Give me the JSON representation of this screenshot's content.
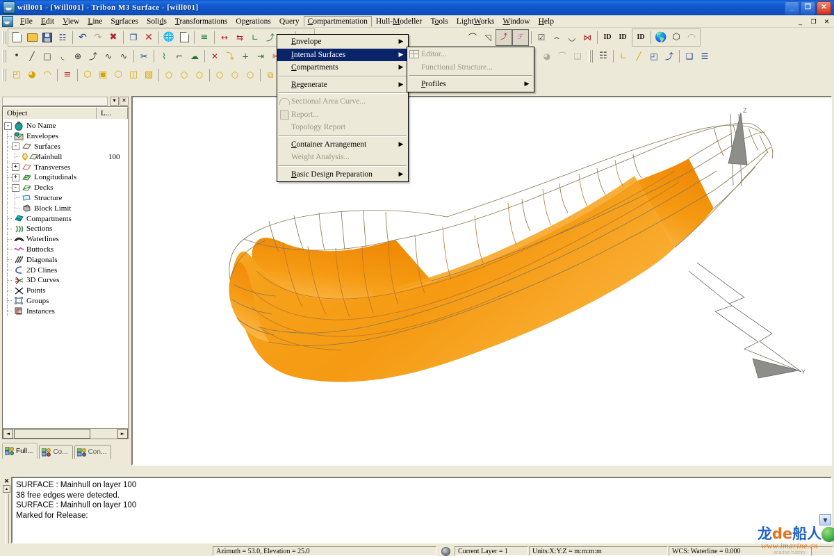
{
  "window": {
    "title": "will001 - [Will001] - Tribon M3 Surface - [will001]",
    "minimize": "_",
    "restore": "❐",
    "close": "✕",
    "mdi_minimize": "_",
    "mdi_restore": "❐",
    "mdi_close": "✕"
  },
  "menubar": {
    "items": [
      {
        "label": "File"
      },
      {
        "label": "Edit"
      },
      {
        "label": "View"
      },
      {
        "label": "Line"
      },
      {
        "label": "Surfaces"
      },
      {
        "label": "Solids"
      },
      {
        "label": "Transformations"
      },
      {
        "label": "Operations"
      },
      {
        "label": "Query"
      },
      {
        "label": "Compartmentation"
      },
      {
        "label": "Hull-Modeller"
      },
      {
        "label": "Tools"
      },
      {
        "label": "LightWorks"
      },
      {
        "label": "Window"
      },
      {
        "label": "Help"
      }
    ]
  },
  "compartmentation_menu": {
    "items": [
      {
        "label": "Envelope",
        "arrow": "▶",
        "disabled": false,
        "highlight": false
      },
      {
        "label": "Internal Surfaces",
        "arrow": "▶",
        "disabled": false,
        "highlight": true
      },
      {
        "label": "Compartments",
        "arrow": "▶",
        "disabled": false,
        "highlight": false
      },
      {
        "separator": true
      },
      {
        "label": "Regenerate",
        "arrow": "▶",
        "disabled": false,
        "highlight": false
      },
      {
        "separator": true
      },
      {
        "label": "Sectional Area Curve...",
        "arrow": "",
        "disabled": true,
        "highlight": false
      },
      {
        "label": "Report...",
        "arrow": "",
        "disabled": true,
        "highlight": false
      },
      {
        "label": "Topology Report",
        "arrow": "",
        "disabled": true,
        "highlight": false
      },
      {
        "separator": true
      },
      {
        "label": "Container Arrangement",
        "arrow": "▶",
        "disabled": false,
        "highlight": false
      },
      {
        "label": "Weight Analysis...",
        "arrow": "",
        "disabled": true,
        "highlight": false
      },
      {
        "separator": true
      },
      {
        "label": "Basic Design Preparation",
        "arrow": "▶",
        "disabled": false,
        "highlight": false
      }
    ]
  },
  "internal_surfaces_submenu": {
    "items": [
      {
        "label": "Editor...",
        "arrow": "",
        "disabled": true,
        "icon": true
      },
      {
        "label": "Functional Structure...",
        "arrow": "",
        "disabled": true,
        "icon": false
      },
      {
        "separator": true
      },
      {
        "label": "Profiles",
        "arrow": "▶",
        "disabled": false,
        "icon": false
      }
    ]
  },
  "sidebar": {
    "columns": [
      "Object",
      "L..."
    ],
    "tree": [
      {
        "label": "No Name",
        "value": "",
        "depth": 0,
        "expander": "-",
        "icon": "ship-icon"
      },
      {
        "label": "Envelopes",
        "value": "",
        "depth": 1,
        "expander": "",
        "icon": "envelopes-icon"
      },
      {
        "label": "Surfaces",
        "value": "",
        "depth": 1,
        "expander": "-",
        "icon": "surfaces-icon"
      },
      {
        "label": "Mainhull",
        "value": "100",
        "depth": 2,
        "expander": "",
        "icon": "mainhull-icon"
      },
      {
        "label": "Transverses",
        "value": "",
        "depth": 1,
        "expander": "+",
        "icon": "transverses-icon"
      },
      {
        "label": "Longitudinals",
        "value": "",
        "depth": 1,
        "expander": "+",
        "icon": "longitudinals-icon"
      },
      {
        "label": "Decks",
        "value": "",
        "depth": 1,
        "expander": "-",
        "icon": "decks-icon"
      },
      {
        "label": "Structure",
        "value": "",
        "depth": 2,
        "expander": "",
        "icon": "structure-icon"
      },
      {
        "label": "Block Limit",
        "value": "",
        "depth": 2,
        "expander": "",
        "icon": "block-limit-icon"
      },
      {
        "label": "Compartments",
        "value": "",
        "depth": 1,
        "expander": "",
        "icon": "compartments-icon"
      },
      {
        "label": "Sections",
        "value": "",
        "depth": 1,
        "expander": "",
        "icon": "sections-icon"
      },
      {
        "label": "Waterlines",
        "value": "",
        "depth": 1,
        "expander": "",
        "icon": "waterlines-icon"
      },
      {
        "label": "Buttocks",
        "value": "",
        "depth": 1,
        "expander": "",
        "icon": "buttocks-icon"
      },
      {
        "label": "Diagonals",
        "value": "",
        "depth": 1,
        "expander": "",
        "icon": "diagonals-icon"
      },
      {
        "label": "2D Clines",
        "value": "",
        "depth": 1,
        "expander": "",
        "icon": "2d-clines-icon"
      },
      {
        "label": "3D Curves",
        "value": "",
        "depth": 1,
        "expander": "",
        "icon": "3d-curves-icon"
      },
      {
        "label": "Points",
        "value": "",
        "depth": 1,
        "expander": "",
        "icon": "points-icon"
      },
      {
        "label": "Groups",
        "value": "",
        "depth": 1,
        "expander": "",
        "icon": "groups-icon"
      },
      {
        "label": "Instances",
        "value": "",
        "depth": 1,
        "expander": "",
        "icon": "instances-icon"
      }
    ],
    "tabs": [
      {
        "label": "Full...",
        "active": true
      },
      {
        "label": "Co...",
        "active": false
      },
      {
        "label": "Con...",
        "active": false
      }
    ],
    "scroll_left": "◄",
    "scroll_right": "►",
    "caption_dropdown": "▾",
    "caption_close": "✕"
  },
  "messages": {
    "lines": [
      "SURFACE : Mainhull on layer 100",
      "38 free edges were detected.",
      "SURFACE : Mainhull on layer 100",
      "Marked for Release:"
    ],
    "close": "✕",
    "scroll_up": "▴"
  },
  "statusbar": {
    "view_info": "Azimuth = 53.0, Elevation = 25.0",
    "current_layer": "Current Layer = 1",
    "units": "Units:X:Y:Z = m:m:m:m",
    "wcs": "WCS: Waterline = 0.000"
  },
  "viewport": {
    "axis_z_label": "Z",
    "axis_y_label": "Y",
    "hull_color": "#F59A12",
    "hull_color_light": "#FBC95E",
    "wire_color": "#8a7a52"
  },
  "watermark": {
    "logo_1": "龙",
    "logo_2": "de",
    "logo_3": "船人",
    "url": "www.imarine.cn",
    "sub": "imarine history"
  },
  "toolbars": {
    "row1": [
      {
        "name": "new-document-button",
        "glyph": "page"
      },
      {
        "name": "open-file-button",
        "glyph": "folder"
      },
      {
        "name": "save-button",
        "glyph": "disk"
      },
      {
        "name": "save-all-button",
        "glyph": "disk-multi"
      },
      {
        "sep": true
      },
      {
        "name": "undo-button",
        "glyph": "↶",
        "cls": "blue"
      },
      {
        "name": "redo-button",
        "glyph": "↷",
        "cls": "dim"
      },
      {
        "name": "delete-undo-button",
        "glyph": "✖",
        "cls": "red"
      },
      {
        "sep": true
      },
      {
        "name": "copy-button",
        "glyph": "❐",
        "cls": "blue"
      },
      {
        "name": "delete-button",
        "glyph": "✕",
        "cls": "red"
      },
      {
        "sep": true
      },
      {
        "name": "project-button",
        "glyph": "globe"
      },
      {
        "name": "blank-page-button",
        "glyph": "page"
      },
      {
        "sep": true
      },
      {
        "name": "layers-button",
        "glyph": "≡",
        "cls": "green"
      },
      {
        "sep": true
      },
      {
        "name": "dimension-horizontal-button",
        "glyph": "↔",
        "cls": "red"
      },
      {
        "name": "dimension-aft-button",
        "glyph": "⇆",
        "cls": "red"
      },
      {
        "name": "dimension-angle-button",
        "glyph": "∠",
        "cls": "green"
      },
      {
        "name": "dimension-point-button",
        "glyph": "⤴",
        "cls": "green"
      },
      {
        "name": "grid-button",
        "glyph": "▒",
        "cls": "red"
      },
      {
        "sep": true
      },
      {
        "name": "node-edit-button",
        "glyph": "⬡",
        "cls": "green"
      }
    ],
    "row1b": [
      {
        "name": "curve-tool-1-button",
        "glyph": "∠"
      },
      {
        "name": "curve-tool-2-button",
        "glyph": "◱"
      },
      {
        "name": "curve-tool-3-button",
        "glyph": "⤴",
        "cls": "red"
      },
      {
        "name": "curve-tool-4-button",
        "glyph": "⌱",
        "cls": "pink",
        "pressed": true
      },
      {
        "sep": true
      },
      {
        "name": "surface-tool-1-button",
        "glyph": "☑"
      },
      {
        "name": "surface-tool-2-button",
        "glyph": "◠"
      },
      {
        "name": "surface-tool-3-button",
        "glyph": "⌓"
      },
      {
        "name": "surface-tool-4-button",
        "glyph": "⋈",
        "cls": "red"
      },
      {
        "sep": true
      },
      {
        "name": "id-label-button",
        "glyph": "ID"
      },
      {
        "name": "id-arrow-button",
        "glyph": "ID"
      },
      {
        "name": "id-axis-button",
        "glyph": "ID"
      }
    ],
    "row1c": [
      {
        "name": "render-globe-button",
        "glyph": "globe"
      },
      {
        "name": "render-box-button",
        "glyph": "⬡"
      },
      {
        "name": "render-shade-button",
        "glyph": "◠",
        "cls": "dim"
      }
    ],
    "row2": [
      {
        "name": "point-tool-button",
        "glyph": "•"
      },
      {
        "name": "line-tool-button",
        "glyph": "╱"
      },
      {
        "name": "rectangle-tool-button",
        "glyph": "□"
      },
      {
        "name": "arc-tool-button",
        "glyph": "◟"
      },
      {
        "name": "circle-tool-button",
        "glyph": "⊕"
      },
      {
        "name": "spline-tool-button",
        "glyph": "⤴"
      },
      {
        "name": "curve-tool-button",
        "glyph": "∿"
      },
      {
        "name": "nurbs-tool-button",
        "glyph": "∿"
      },
      {
        "sep": true
      },
      {
        "name": "trim-scissors-button",
        "glyph": "✂",
        "cls": "blue"
      },
      {
        "sep": true
      },
      {
        "name": "modify-curve-button",
        "glyph": "⌇",
        "cls": "green"
      },
      {
        "name": "corner-button",
        "glyph": "⌐"
      },
      {
        "name": "fill-button",
        "glyph": "☁",
        "cls": "green"
      },
      {
        "sep": true
      },
      {
        "name": "intersect-button",
        "glyph": "✕",
        "cls": "red"
      },
      {
        "name": "offset-button",
        "glyph": "⤵",
        "cls": "gold"
      },
      {
        "name": "extend-button",
        "glyph": "┤",
        "cls": "green"
      },
      {
        "name": "project-curve-button",
        "glyph": "⇥",
        "cls": "green"
      },
      {
        "name": "split-button",
        "glyph": "✄",
        "cls": "red"
      },
      {
        "name": "join-button",
        "glyph": "⤳",
        "cls": "green"
      },
      {
        "name": "smooth-button",
        "glyph": "∿",
        "cls": "gold"
      },
      {
        "sep": true
      },
      {
        "name": "surface-fair-button",
        "glyph": "◔",
        "cls": "dim"
      },
      {
        "name": "surface-arc-button",
        "glyph": "⌒",
        "cls": "dim"
      },
      {
        "name": "surface-page-button",
        "glyph": "❑",
        "cls": "dim"
      },
      {
        "sep": true
      },
      {
        "name": "properties-button",
        "glyph": "☰",
        "cls": "blue"
      },
      {
        "sep": true
      },
      {
        "name": "query-angle-button",
        "glyph": "∠",
        "cls": "gold"
      },
      {
        "name": "query-length-button",
        "glyph": "╱",
        "cls": "gold"
      },
      {
        "name": "query-area-button",
        "glyph": "◰",
        "cls": "blue"
      },
      {
        "name": "query-curve-button",
        "glyph": "⤴",
        "cls": "blue"
      },
      {
        "sep": true
      },
      {
        "name": "report-info-button",
        "glyph": "❑",
        "cls": "blue"
      },
      {
        "name": "report-list-button",
        "glyph": "☰",
        "cls": "blue"
      }
    ],
    "row3": [
      {
        "name": "solid-1-button",
        "glyph": "◰",
        "cls": "gold"
      },
      {
        "name": "solid-2-button",
        "glyph": "◕",
        "cls": "gold"
      },
      {
        "name": "solid-3-button",
        "glyph": "◠",
        "cls": "gold"
      },
      {
        "sep": true
      },
      {
        "name": "solid-stack-button",
        "glyph": "≡",
        "cls": "red"
      },
      {
        "sep": true
      },
      {
        "name": "compart-1-button",
        "glyph": "⬡",
        "cls": "gold"
      },
      {
        "name": "compart-2-button",
        "glyph": "▣",
        "cls": "gold"
      },
      {
        "name": "compart-3-button",
        "glyph": "⬡",
        "cls": "gold"
      },
      {
        "name": "compart-4-button",
        "glyph": "◫",
        "cls": "gold"
      },
      {
        "name": "compart-5-button",
        "glyph": "▧",
        "cls": "gold"
      },
      {
        "sep": true
      },
      {
        "name": "group-ok-button",
        "glyph": "⬡",
        "cls": "gold"
      },
      {
        "name": "group-ot-button",
        "glyph": "⬡",
        "cls": "gold"
      },
      {
        "name": "group-oc-button",
        "glyph": "⬡",
        "cls": "gold"
      },
      {
        "sep": true
      },
      {
        "name": "grid-ok-button",
        "glyph": "⬡",
        "cls": "gold"
      },
      {
        "name": "grid-ot-button",
        "glyph": "⬡",
        "cls": "gold"
      },
      {
        "name": "grid-oc-button",
        "glyph": "⬡",
        "cls": "gold"
      },
      {
        "sep": true
      },
      {
        "name": "pair-1-button",
        "glyph": "⧉",
        "cls": "gold"
      },
      {
        "name": "pair-2-button",
        "glyph": "⧉",
        "cls": "gold"
      },
      {
        "name": "pair-3-button",
        "glyph": "⧉",
        "cls": "gold"
      }
    ]
  }
}
